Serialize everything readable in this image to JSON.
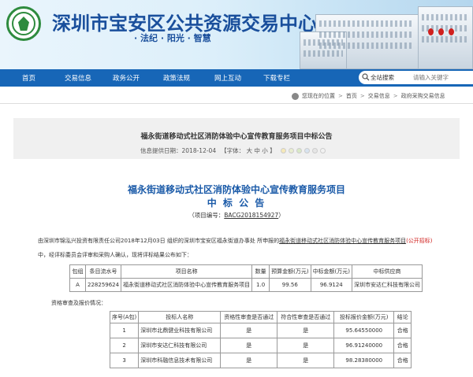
{
  "header": {
    "title": "深圳市宝安区公共资源交易中心",
    "slogan": "· 法纪 · 阳光 · 智慧"
  },
  "nav": {
    "items": [
      "首页",
      "交易信息",
      "政务公开",
      "政策法规",
      "网上互动",
      "下载专栏"
    ]
  },
  "search": {
    "label": "全站搜索",
    "placeholder": "请输入关键字"
  },
  "breadcrumb": {
    "prefix": "您现在的位置",
    "items": [
      "首页",
      "交易信息",
      "政府采购交易信息"
    ]
  },
  "announcement": {
    "title": "福永街道移动式社区消防体验中心宣传教育服务项目中标公告",
    "date_label": "信息提供日期：2018-12-04",
    "font_label": "【字体：",
    "font_sizes": [
      "大",
      "中",
      "小"
    ],
    "font_end": "】",
    "color_dots": [
      "#f6e9b8",
      "#e8edd0",
      "#d9e9c6",
      "#d8e4f0",
      "#e6e6e6",
      "#f1f1f1"
    ]
  },
  "body": {
    "heading": "福永街道移动式社区消防体验中心宣传教育服务项目",
    "subheading": "中 标 公 告",
    "code_prefix": "（项目编号：",
    "code_value": "BACG2018154927",
    "code_suffix": "）",
    "p1_part1": "由深圳市锦泓兴投资有限责任公司2018年12月03日 组织的深圳市宝安区福永街道办事处 所申报的",
    "p1_link": "福永街道移动式社区消防体验中心宣传教育服务项目",
    "p1_red": "(公开招标)",
    "p2": "中，经评标委员会评审和采购人确认，现将评标结果公布如下：",
    "p3": "资格审查及报价情况："
  },
  "result_table": {
    "headers": [
      "包组",
      "条目流水号",
      "项目名称",
      "数量",
      "预算金额(万元)",
      "中标金额(万元)",
      "中标供应商"
    ],
    "rows": [
      [
        "A",
        "228259624",
        "福永街道移动式社区消防体验中心宣传教育服务项目",
        "1.0",
        "99.56",
        "96.9124",
        "深圳市安达仁科技有限公司"
      ]
    ]
  },
  "qual_table": {
    "headers": [
      "序号(A包)",
      "投标人名称",
      "资格性审查是否通过",
      "符合性审查是否通过",
      "投标报价金额(万元)",
      "结论"
    ],
    "rows": [
      [
        "1",
        "深圳市北鼎健业科技有限公司",
        "是",
        "是",
        "95.64550000",
        "合格"
      ],
      [
        "2",
        "深圳市安达仁科技有限公司",
        "是",
        "是",
        "96.91240000",
        "合格"
      ],
      [
        "3",
        "深圳市科融信息技术有限公司",
        "是",
        "是",
        "98.28380000",
        "合格"
      ]
    ]
  }
}
